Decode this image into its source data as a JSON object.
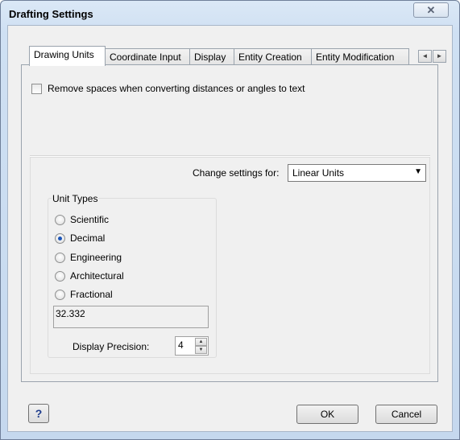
{
  "window": {
    "title": "Drafting Settings",
    "close_glyph": "✕"
  },
  "tabs": [
    {
      "label": "Drawing Units",
      "active": true
    },
    {
      "label": "Coordinate Input",
      "active": false
    },
    {
      "label": "Display",
      "active": false
    },
    {
      "label": "Entity Creation",
      "active": false
    },
    {
      "label": "Entity Modification",
      "active": false
    }
  ],
  "tab_scroll": {
    "left_icon": "◄",
    "right_icon": "►"
  },
  "remove_spaces": {
    "label": "Remove spaces when converting distances or angles to text",
    "checked": false
  },
  "change_settings": {
    "label": "Change settings for:",
    "value": "Linear Units",
    "arrow": "▼"
  },
  "unit_types": {
    "legend": "Unit Types",
    "options": [
      {
        "label": "Scientific",
        "checked": false
      },
      {
        "label": "Decimal",
        "checked": true
      },
      {
        "label": "Engineering",
        "checked": false
      },
      {
        "label": "Architectural",
        "checked": false
      },
      {
        "label": "Fractional",
        "checked": false
      }
    ],
    "preview": "32.332"
  },
  "display_precision": {
    "label": "Display Precision:",
    "value": "4",
    "up_icon": "▲",
    "down_icon": "▼"
  },
  "buttons": {
    "help": "?",
    "ok": "OK",
    "cancel": "Cancel"
  }
}
